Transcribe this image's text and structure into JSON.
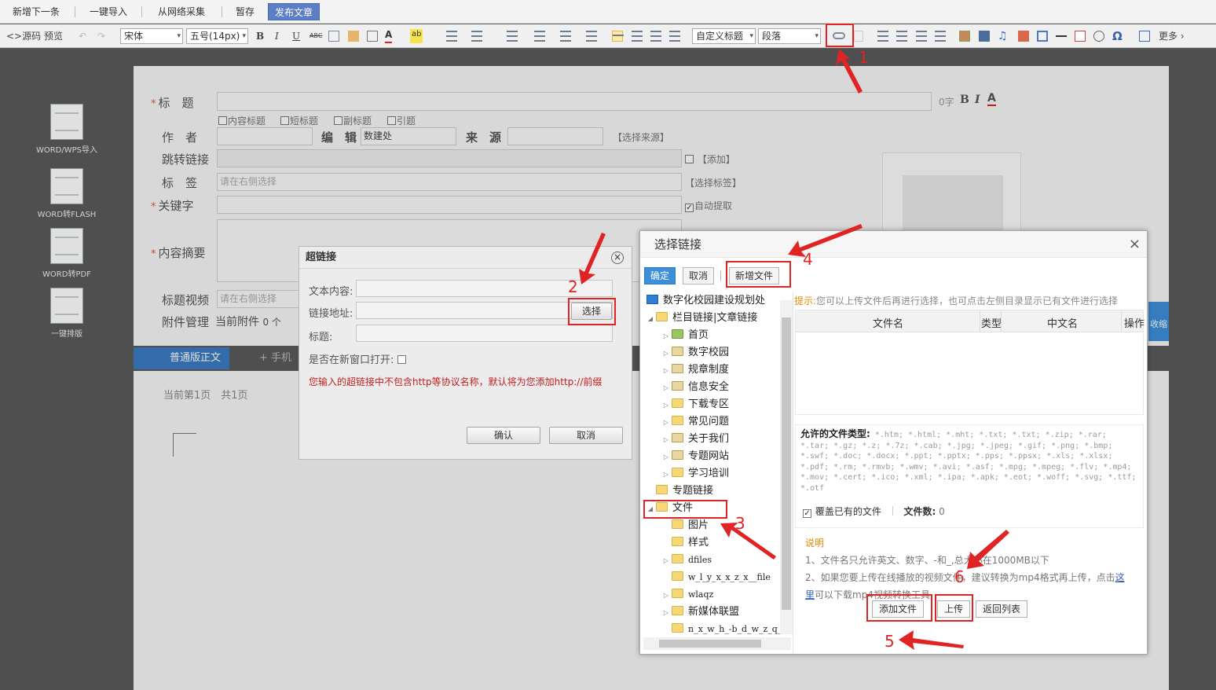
{
  "action_bar": [
    "新增下一条",
    "一键导入",
    "从网络采集",
    "暂存",
    "发布文章"
  ],
  "toolbar": {
    "source": "<>源码",
    "preview": "预览",
    "font_family": "宋体",
    "font_size": "五号(14px)",
    "bold": "B",
    "italic": "I",
    "underline": "U",
    "strike": "ABC",
    "custom_title": "自定义标题",
    "paragraph": "段落",
    "omega": "Ω",
    "more": "更多"
  },
  "sidebar": [
    "WORD/WPS导入",
    "WORD转FLASH",
    "WORD转PDF",
    "一键排版"
  ],
  "form": {
    "title_label": "标　题",
    "char_count": "0字",
    "title_checks": [
      "内容标题",
      "短标题",
      "副标题",
      "引题"
    ],
    "author_label": "作　者",
    "editor_label": "编　辑",
    "editor_value": "数建处",
    "source_label": "来　源",
    "choose_source": "【选择来源】",
    "jump_label": "跳转链接",
    "add_link": "【添加】",
    "tag_label": "标　签",
    "tag_placeholder": "请在右侧选择",
    "choose_tag": "【选择标签】",
    "keyword_label": "关键字",
    "auto_extract": "自动提取",
    "summary_label": "内容摘要",
    "video_label": "标题视频",
    "video_placeholder": "请在右侧选择",
    "attach_label": "附件管理",
    "attach_text": "当前附件",
    "attach_count": "0 个",
    "collapse": "收缩",
    "tab_normal": "普通版正文",
    "tab_mobile": "+ 手机",
    "page_info": "当前第1页　共1页"
  },
  "hyperlink_dialog": {
    "title": "超链接",
    "text_label": "文本内容:",
    "url_label": "链接地址:",
    "choose_btn": "选择",
    "title_label": "标题:",
    "new_window": "是否在新窗口打开:",
    "warning": "您输入的超链接中不包含http等协议名称，默认将为您添加http://前缀",
    "ok": "确认",
    "cancel": "取消"
  },
  "choose_dialog": {
    "title": "选择链接",
    "ok": "确定",
    "cancel": "取消",
    "new_file": "新增文件",
    "tree": [
      {
        "label": "数字化校园建设规划处",
        "level": 0,
        "icon": "computer",
        "arrow": ""
      },
      {
        "label": "栏目链接|文章链接",
        "level": 1,
        "icon": "folder",
        "arrow": "▲"
      },
      {
        "label": "首页",
        "level": 2,
        "icon": "home",
        "arrow": "▷"
      },
      {
        "label": "数字校园",
        "level": 2,
        "icon": "chain",
        "arrow": "▷"
      },
      {
        "label": "规章制度",
        "level": 2,
        "icon": "chain",
        "arrow": "▷"
      },
      {
        "label": "信息安全",
        "level": 2,
        "icon": "chain",
        "arrow": "▷"
      },
      {
        "label": "下载专区",
        "level": 2,
        "icon": "folder",
        "arrow": "▷"
      },
      {
        "label": "常见问题",
        "level": 2,
        "icon": "folder",
        "arrow": "▷"
      },
      {
        "label": "关于我们",
        "level": 2,
        "icon": "chain",
        "arrow": "▷"
      },
      {
        "label": "专题网站",
        "level": 2,
        "icon": "chain",
        "arrow": "▷"
      },
      {
        "label": "学习培训",
        "level": 2,
        "icon": "folder",
        "arrow": "▷"
      },
      {
        "label": "专题链接",
        "level": 1,
        "icon": "folder",
        "arrow": ""
      },
      {
        "label": "文件",
        "level": 1,
        "icon": "folder",
        "arrow": "▲"
      },
      {
        "label": "图片",
        "level": 2,
        "icon": "folder",
        "arrow": ""
      },
      {
        "label": "样式",
        "level": 2,
        "icon": "folder",
        "arrow": ""
      },
      {
        "label": "dfiles",
        "level": 2,
        "icon": "folder",
        "arrow": "▷"
      },
      {
        "label": "w_l_y_x_x_z_x__file",
        "level": 2,
        "icon": "folder",
        "arrow": ""
      },
      {
        "label": "wlaqz",
        "level": 2,
        "icon": "folder",
        "arrow": "▷"
      },
      {
        "label": "新媒体联盟",
        "level": 2,
        "icon": "folder",
        "arrow": "▷"
      },
      {
        "label": "n_x_w_h_-b_d_w_z_q_",
        "level": 2,
        "icon": "folder",
        "arrow": ""
      }
    ],
    "hint_prefix": "提示:",
    "hint": "您可以上传文件后再进行选择，也可点击左侧目录显示已有文件进行选择",
    "columns": [
      "文件名",
      "类型",
      "中文名",
      "操作"
    ],
    "allowed_label": "允许的文件类型:",
    "allowed_types": "*.htm; *.html; *.mht; *.txt; *.txt; *.zip; *.rar; *.tar; *.gz; *.z; *.7z; *.cab; *.jpg; *.jpeg; *.gif; *.png; *.bmp; *.swf; *.doc; *.docx; *.ppt; *.pptx; *.pps; *.ppsx; *.xls; *.xlsx; *.pdf; *.rm; *.rmvb; *.wmv; *.avi; *.asf; *.mpg; *.mpeg; *.flv; *.mp4; *.mov; *.cert; *.ico; *.xml; *.ipa; *.apk; *.eot; *.woff; *.svg; *.ttf; *.otf",
    "overwrite": "覆盖已有的文件",
    "file_count_label": "文件数:",
    "file_count": "0",
    "notes_title": "说明",
    "note1": "1、文件名只允许英文、数字、-和_,总大小在1000MB以下",
    "note2a": "2、如果您要上传在线播放的视频文件，建议转换为mp4格式再上传，点击",
    "note2_link1": "这",
    "note2_link2": "里",
    "note2b": "可以下载mp4视频转换工具",
    "add_file": "添加文件",
    "upload": "上传",
    "back": "返回列表"
  },
  "annotations": [
    "1",
    "2",
    "3",
    "4",
    "5",
    "6"
  ],
  "colors": {
    "annotation": "#e02424",
    "primary": "#3d8fd8",
    "publish": "#5b7ec5"
  }
}
